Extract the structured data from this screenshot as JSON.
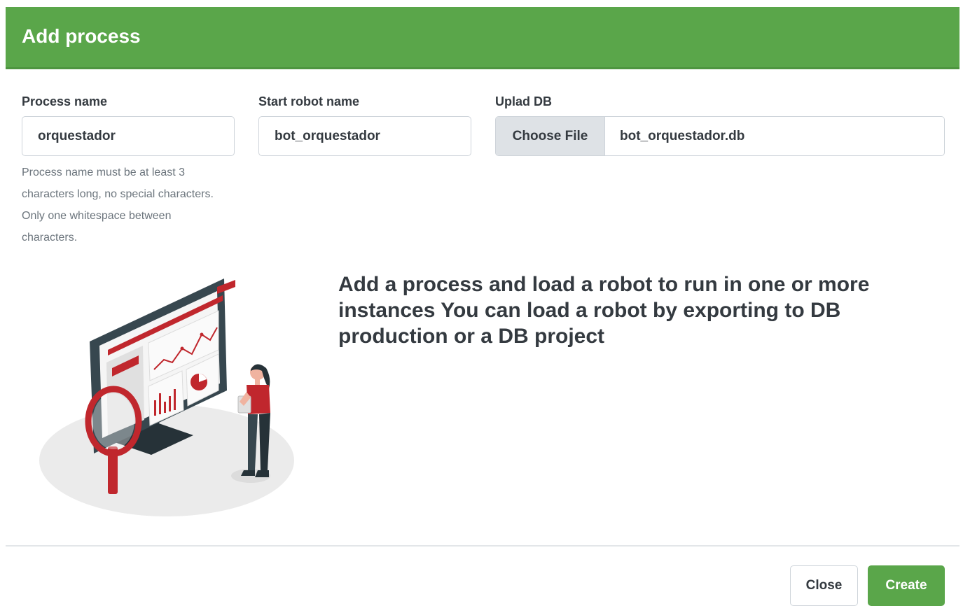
{
  "modal": {
    "title": "Add process"
  },
  "form": {
    "process_name": {
      "label": "Process name",
      "value": "orquestador",
      "help": "Process name must be at least 3 characters long, no special characters. Only one whitespace between characters."
    },
    "start_robot_name": {
      "label": "Start robot name",
      "value": "bot_orquestador"
    },
    "upload_db": {
      "label": "Uplad DB",
      "button_label": "Choose File",
      "file_name": "bot_orquestador.db"
    }
  },
  "content": {
    "description": "Add a process and load a robot to run in one or more instances You can load a robot by exporting to DB production or a DB project",
    "illustration": "analytics-dashboard-illustration"
  },
  "footer": {
    "close_label": "Close",
    "create_label": "Create"
  },
  "colors": {
    "header": "#5aa64a",
    "accent_red": "#c0272d",
    "text": "#343a40"
  }
}
